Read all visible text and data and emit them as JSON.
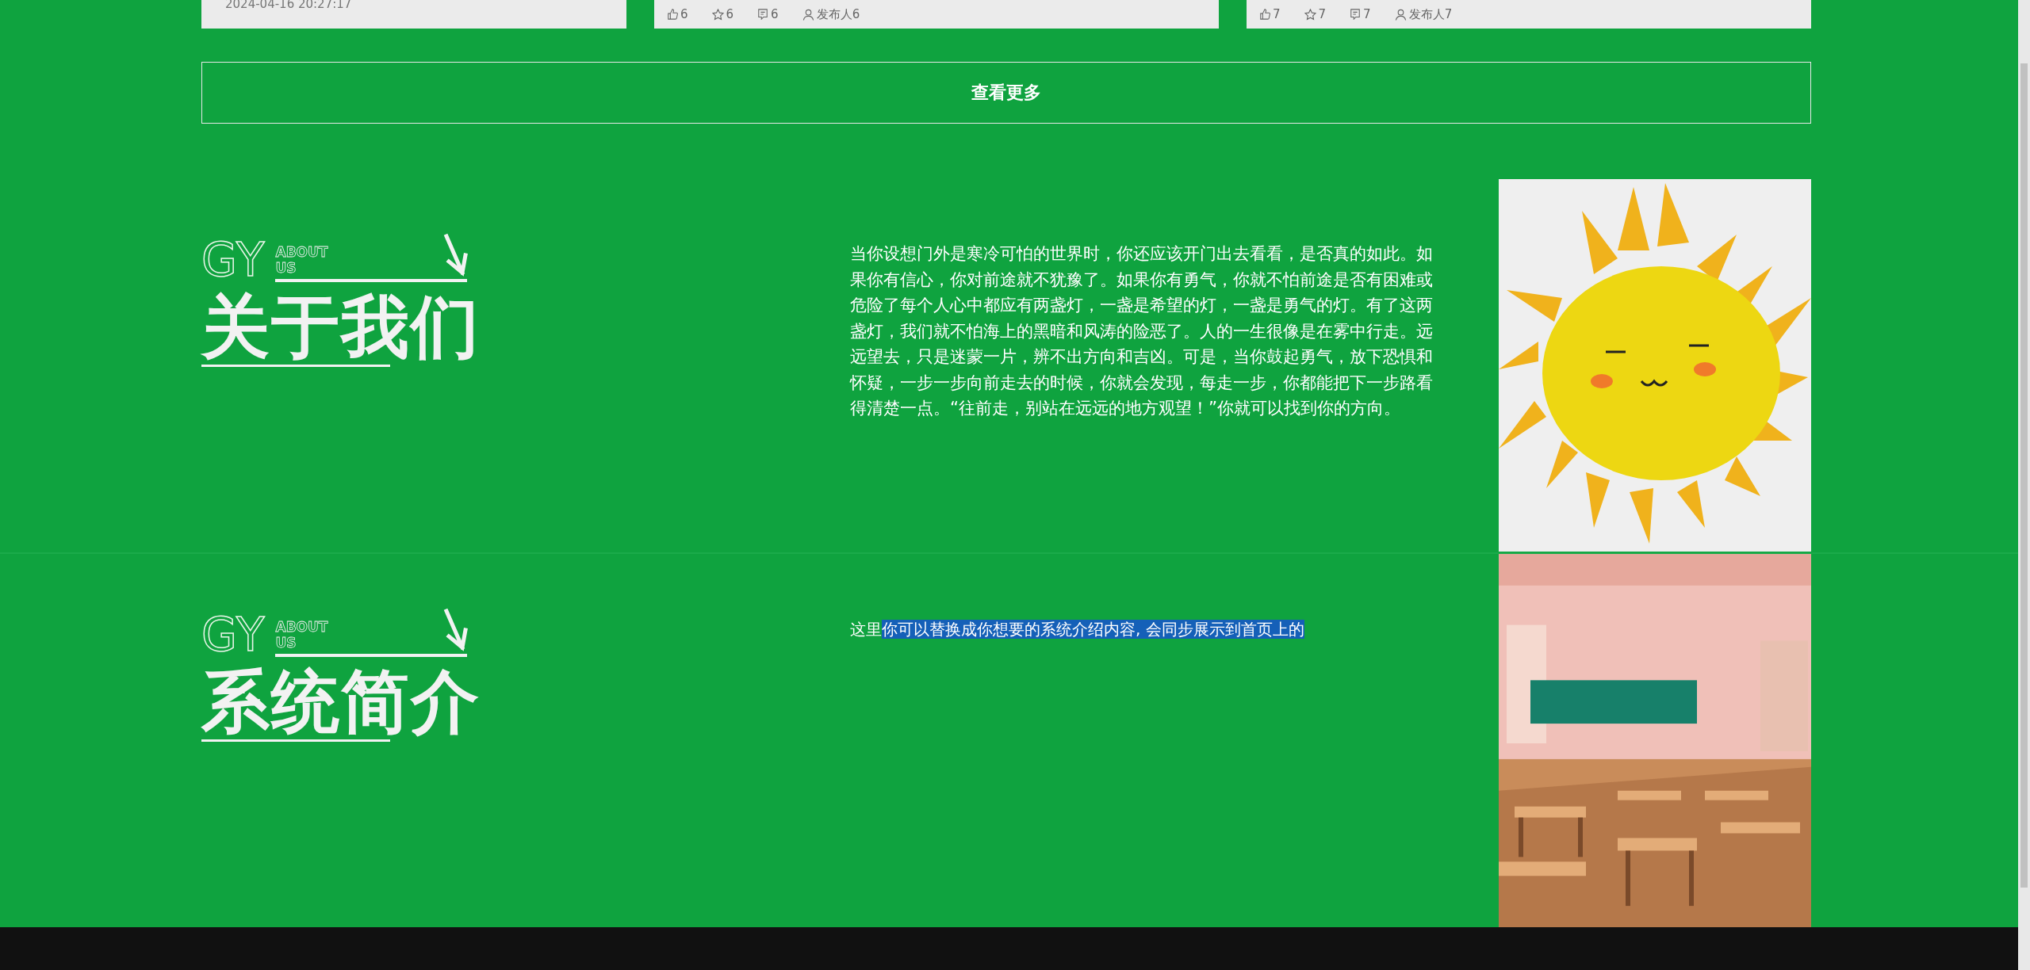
{
  "cards": [
    {
      "kind": "date",
      "date": "2024-04-16 20:27:17"
    },
    {
      "kind": "stats",
      "likes": "6",
      "favorites": "6",
      "comments": "6",
      "author": "发布人6"
    },
    {
      "kind": "stats",
      "likes": "7",
      "favorites": "7",
      "comments": "7",
      "author": "发布人7"
    }
  ],
  "more_button": "查看更多",
  "sections": [
    {
      "badge": "GY",
      "badge_sub": [
        "ABOUT",
        "US"
      ],
      "title": "关于我们",
      "segments": [
        {
          "text": "当你设想门外是寒冷可怕的世界时，你还应该开门出去看看，是否真的如此。如果你有信心，你对前途就不犹豫了。如果你有勇气，你就不怕前途是否有困难或危险了每个人心中都应有两盏灯，一盏是希望的灯，一盏是勇气的灯。有了这两盏灯，我们就不怕海上的黑暗和风涛的险恶了。人的一生很像是在雾中行走。远远望去，只是迷蒙一片，辨不出方向和吉凶。可是，当你鼓起勇气，放下恐惧和怀疑，一步一步向前走去的时候，你就会发现，每走一步，你都能把下一步路看得清楚一点。“往前走，别站在远远的地方观望！”你就可以找到你的方向。",
          "selected": false
        }
      ]
    },
    {
      "badge": "GY",
      "badge_sub": [
        "ABOUT",
        "US"
      ],
      "title": "系统简介",
      "segments": [
        {
          "text": "这里",
          "selected": false
        },
        {
          "text": "你可以替换成你想要的系统介绍内容, 会同步展示到首页上的",
          "selected": true
        }
      ]
    }
  ]
}
